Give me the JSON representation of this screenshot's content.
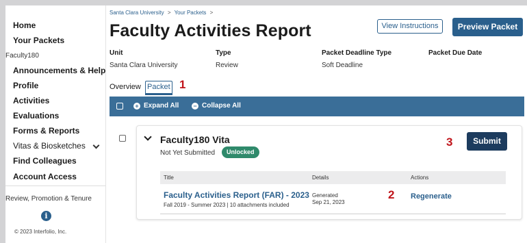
{
  "sidebar": {
    "home": "Home",
    "your_packets": "Your Packets",
    "section_faculty180": "Faculty180",
    "items": [
      {
        "label": "Announcements & Help"
      },
      {
        "label": "Profile"
      },
      {
        "label": "Activities"
      },
      {
        "label": "Evaluations"
      },
      {
        "label": "Forms & Reports"
      },
      {
        "label": "Vitas & Biosketches"
      },
      {
        "label": "Find Colleagues"
      },
      {
        "label": "Account Access"
      }
    ],
    "section_rpt": "Review, Promotion & Tenure",
    "info_icon_glyph": "i",
    "copyright": "© 2023 Interfolio, Inc."
  },
  "breadcrumb": {
    "items": [
      "Santa Clara University",
      "Your Packets"
    ],
    "separator": ">"
  },
  "header": {
    "title": "Faculty Activities Report",
    "view_instructions": "View Instructions",
    "preview_packet": "Preview Packet"
  },
  "info": {
    "unit_label": "Unit",
    "unit_value": "Santa Clara University",
    "type_label": "Type",
    "type_value": "Review",
    "deadline_type_label": "Packet Deadline Type",
    "deadline_type_value": "Soft Deadline",
    "due_date_label": "Packet Due Date"
  },
  "tabs": [
    {
      "label": "Overview",
      "active": false
    },
    {
      "label": "Packet",
      "active": true
    }
  ],
  "annotations": {
    "one": "1",
    "two": "2",
    "three": "3"
  },
  "toolbar": {
    "expand_all": "Expand All",
    "collapse_all": "Collapse All",
    "expand_icon": "+",
    "collapse_icon": "−"
  },
  "card": {
    "title": "Faculty180 Vita",
    "status": "Not Yet Submitted",
    "badge": "Unlocked",
    "submit": "Submit",
    "table": {
      "headers": [
        "Title",
        "Details",
        "Actions"
      ],
      "rows": [
        {
          "title": "Faculty Activities Report (FAR) - 2023",
          "subtitle": "Fall 2019 - Summer 2023 | 10 attachments included",
          "detail_line1": "Generated",
          "detail_line2": "Sep 21, 2023",
          "action": "Regenerate"
        }
      ]
    }
  },
  "colors": {
    "accent": "#2a5f8c",
    "toolbar": "#3a6e98",
    "submit": "#1d3c5e",
    "badge": "#2f8a6b",
    "annotation": "#c0141a"
  }
}
